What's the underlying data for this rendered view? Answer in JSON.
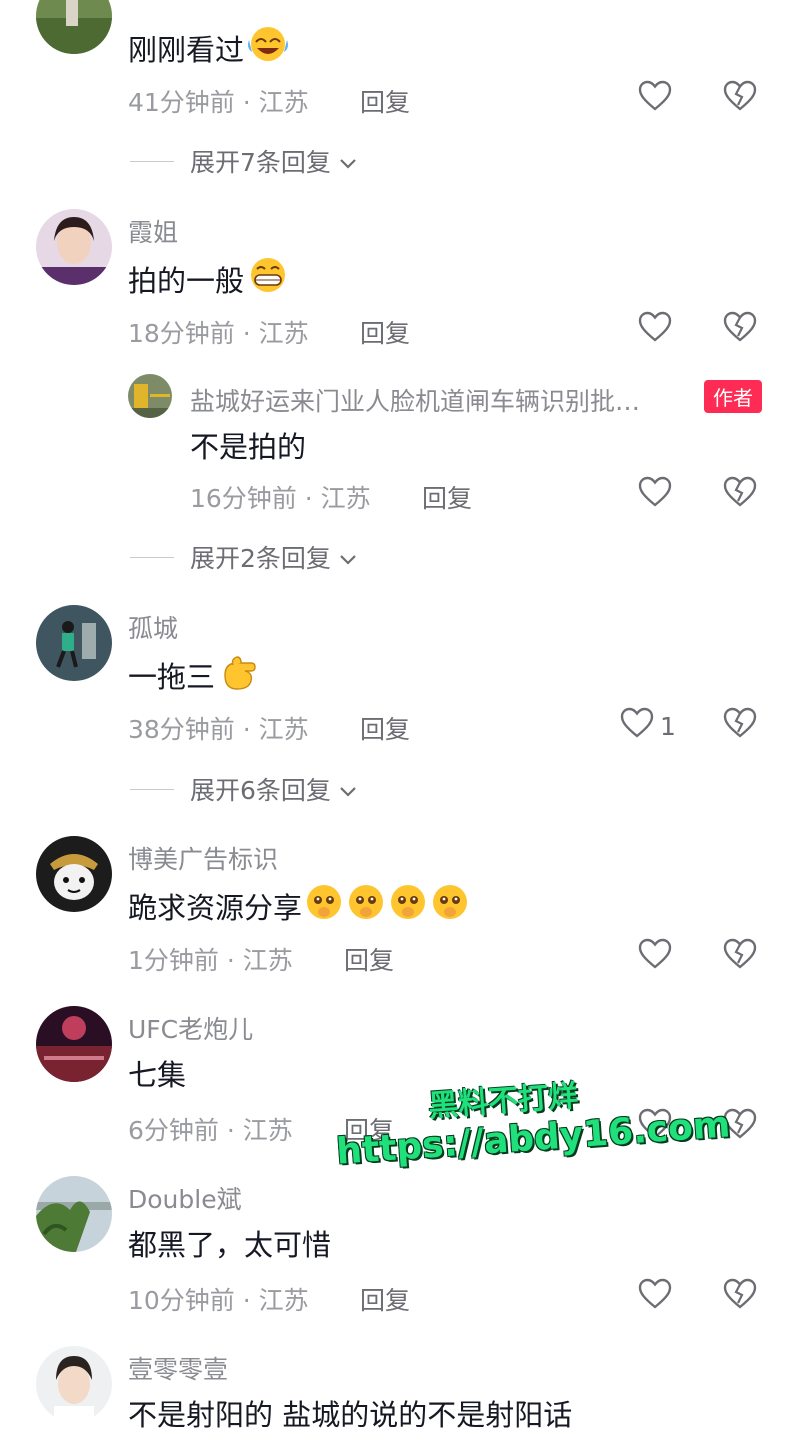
{
  "comments": [
    {
      "name": "",
      "text": "刚刚看过",
      "time_location": "41分钟前 · 江苏",
      "reply_label": "回复",
      "likes": "",
      "expand_label": "展开7条回复"
    },
    {
      "name": "霞姐",
      "text": "拍的一般",
      "time_location": "18分钟前 · 江苏",
      "reply_label": "回复",
      "likes": "",
      "sub_reply": {
        "name": "盐城好运来门业人脸机道闸车辆识别批…",
        "badge": "作者",
        "text": "不是拍的",
        "time_location": "16分钟前 · 江苏",
        "reply_label": "回复"
      },
      "expand_label": "展开2条回复"
    },
    {
      "name": "孤城",
      "text": "一拖三",
      "time_location": "38分钟前 · 江苏",
      "reply_label": "回复",
      "likes": "1",
      "expand_label": "展开6条回复"
    },
    {
      "name": "博美广告标识",
      "text": "跪求资源分享",
      "time_location": "1分钟前 · 江苏",
      "reply_label": "回复",
      "likes": ""
    },
    {
      "name": "UFC老炮儿",
      "text": "七集",
      "time_location": "6分钟前 · 江苏",
      "reply_label": "回复",
      "likes": ""
    },
    {
      "name": "Double斌",
      "text": "都黑了，太可惜",
      "time_location": "10分钟前 · 江苏",
      "reply_label": "回复",
      "likes": ""
    },
    {
      "name": "壹零零壹",
      "text": "不是射阳的 盐城的说的不是射阳话"
    }
  ],
  "watermark": {
    "line1": "黑料不打烊",
    "line2": "https://abdy16.com"
  },
  "icons": {
    "like": "heart-outline-icon",
    "dislike": "broken-heart-icon",
    "expand": "chevron-down-icon"
  },
  "colors": {
    "text": "#161823",
    "name": "#8a8b91",
    "meta": "#9a9ba0",
    "author_badge": "#fe2c55",
    "watermark": "#1fe07a"
  }
}
